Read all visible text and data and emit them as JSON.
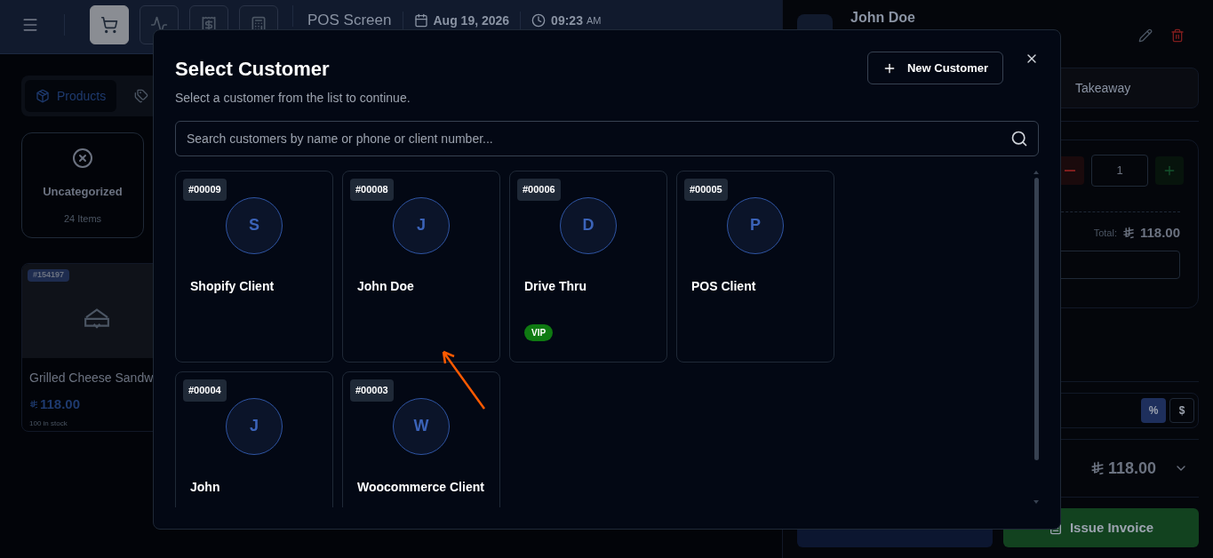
{
  "header": {
    "nav_buttons": [
      {
        "kind": "cart",
        "selected": true
      },
      {
        "kind": "pulse",
        "selected": false
      },
      {
        "kind": "invoice",
        "selected": false
      },
      {
        "kind": "register",
        "selected": false
      }
    ],
    "title": "POS Screen",
    "date": "Aug 19, 2026",
    "time": "09:23",
    "meridiem": "AM"
  },
  "left": {
    "tabs": [
      {
        "label": "Products",
        "selected": true
      }
    ],
    "category": {
      "name": "Uncategorized",
      "count": "24 Items"
    },
    "product": {
      "code": "#154197",
      "name": "Grilled Cheese Sandw",
      "price": "118.00",
      "stock": "100 in stock"
    }
  },
  "cart": {
    "customer": "John Doe",
    "order_type": "Takeaway",
    "quantity": "1",
    "total_label": "Total:",
    "total": "118.00",
    "discount_modes": [
      {
        "label": "%",
        "selected": true
      },
      {
        "label": "$",
        "selected": false
      }
    ],
    "grand_total": "118.00",
    "issue_invoice": "Issue Invoice"
  },
  "modal": {
    "title": "Select Customer",
    "subtitle": "Select a customer from the list to continue.",
    "new_button": "New Customer",
    "search": {
      "placeholder": "Search customers by name or phone or client number..."
    },
    "customers": [
      {
        "number": "#00009",
        "initial": "S",
        "name": "Shopify Client"
      },
      {
        "number": "#00008",
        "initial": "J",
        "name": "John Doe"
      },
      {
        "number": "#00006",
        "initial": "D",
        "name": "Drive Thru",
        "badge": "VIP"
      },
      {
        "number": "#00005",
        "initial": "P",
        "name": "POS Client"
      },
      {
        "number": "#00004",
        "initial": "J",
        "name": "John"
      },
      {
        "number": "#00003",
        "initial": "W",
        "name": "Woocommerce Client"
      }
    ]
  }
}
